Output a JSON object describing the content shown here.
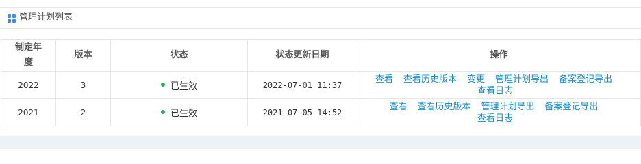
{
  "panel": {
    "title": "管理计划列表",
    "icon": "grid-icon"
  },
  "table": {
    "headers": [
      "制定年度",
      "版本",
      "状态",
      "状态更新日期",
      "操作"
    ],
    "rows": [
      {
        "year": "2022",
        "version": "3",
        "status": "已生效",
        "updated": "2022-07-01 11:37",
        "actions": [
          "查看",
          "查看历史版本",
          "变更",
          "管理计划导出",
          "备案登记导出"
        ],
        "actions_line2": [
          "查看日志"
        ]
      },
      {
        "year": "2021",
        "version": "2",
        "status": "已生效",
        "updated": "2021-07-05 14:52",
        "actions": [
          "查看",
          "查看历史版本",
          "管理计划导出",
          "备案登记导出"
        ],
        "actions_line2": [
          "查看日志"
        ]
      }
    ]
  },
  "colors": {
    "link": "#1a8cc9",
    "status_active": "#27ae60",
    "accent": "#3b8fe0"
  }
}
